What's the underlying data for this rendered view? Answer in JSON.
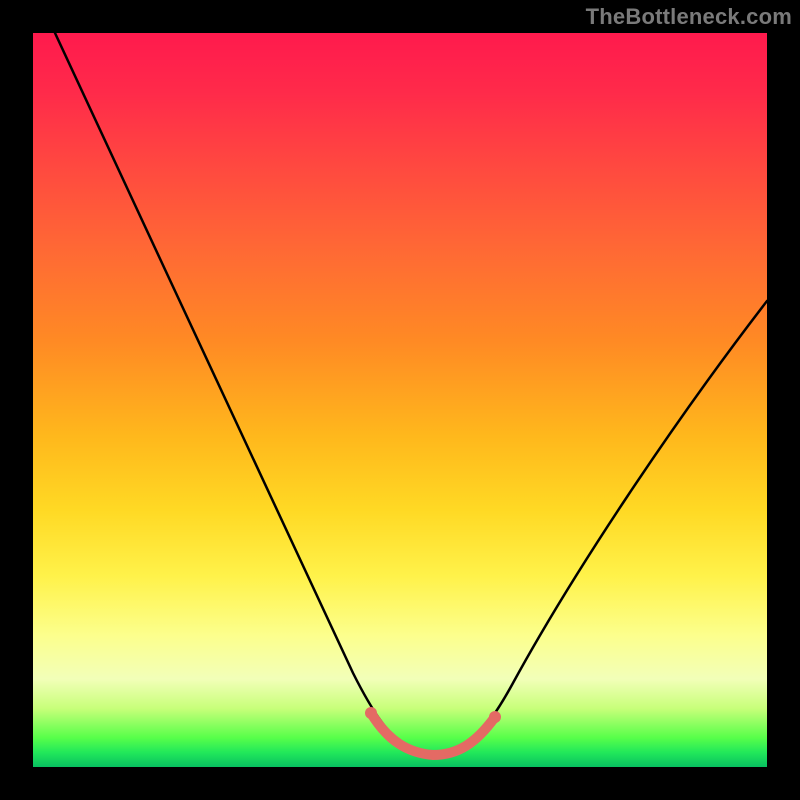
{
  "watermark": "TheBottleneck.com",
  "chart_data": {
    "type": "line",
    "title": "",
    "xlabel": "",
    "ylabel": "",
    "xlim": [
      0,
      100
    ],
    "ylim": [
      0,
      100
    ],
    "grid": false,
    "legend": false,
    "background_gradient": {
      "direction": "vertical",
      "stops": [
        {
          "pos": 0,
          "color": "#ff1a4d"
        },
        {
          "pos": 45,
          "color": "#ff8a24"
        },
        {
          "pos": 70,
          "color": "#ffe040"
        },
        {
          "pos": 88,
          "color": "#f6ffb0"
        },
        {
          "pos": 100,
          "color": "#10c460"
        }
      ]
    },
    "series": [
      {
        "name": "curve-main",
        "color": "#000000",
        "x": [
          3,
          10,
          20,
          30,
          38,
          44,
          48,
          50,
          54,
          58,
          62,
          70,
          80,
          90,
          100
        ],
        "values": [
          100,
          85,
          64,
          43,
          26,
          13,
          5,
          3,
          3,
          5,
          10,
          23,
          40,
          54,
          64
        ]
      },
      {
        "name": "curve-highlight",
        "color": "#e46a64",
        "x": [
          46,
          48,
          50,
          52,
          54,
          56,
          58,
          60
        ],
        "values": [
          5,
          3.5,
          3,
          3,
          3,
          3.5,
          4,
          5
        ]
      }
    ],
    "annotations": []
  }
}
